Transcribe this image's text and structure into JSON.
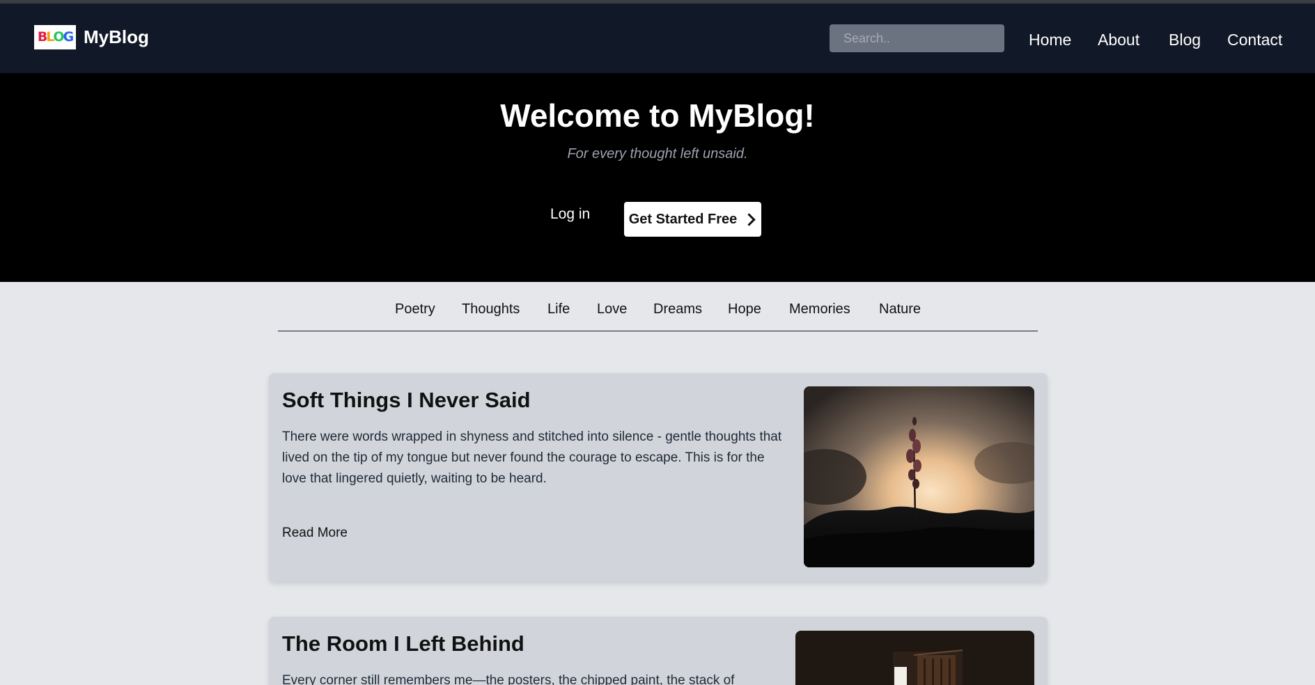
{
  "nav": {
    "brand": "MyBlog",
    "logo_text": "BLOG",
    "search_placeholder": "Search..",
    "links": [
      "Home",
      "About",
      "Blog",
      "Contact"
    ]
  },
  "hero": {
    "title": "Welcome to MyBlog!",
    "subtitle": "For every thought left unsaid.",
    "login_label": "Log in",
    "cta_label": "Get Started Free"
  },
  "categories": [
    "Poetry",
    "Thoughts",
    "Life",
    "Love",
    "Dreams",
    "Hope",
    "Memories",
    "Nature"
  ],
  "posts": [
    {
      "title": "Soft Things I Never Said",
      "excerpt": "There were words wrapped in shyness and stitched into silence - gentle thoughts that lived on the tip of my tongue but never found the courage to escape. This is for the love that lingered quietly, waiting to be heard.",
      "read_more": "Read More"
    },
    {
      "title": "The Room I Left Behind",
      "excerpt": "Every corner still remembers me—the posters, the chipped paint, the stack of"
    }
  ],
  "colors": {
    "navbar_bg": "#111827",
    "hero_bg": "#000000",
    "page_bg": "#e5e7eb",
    "card_bg": "#d1d5db",
    "search_bg": "#6b7280"
  }
}
